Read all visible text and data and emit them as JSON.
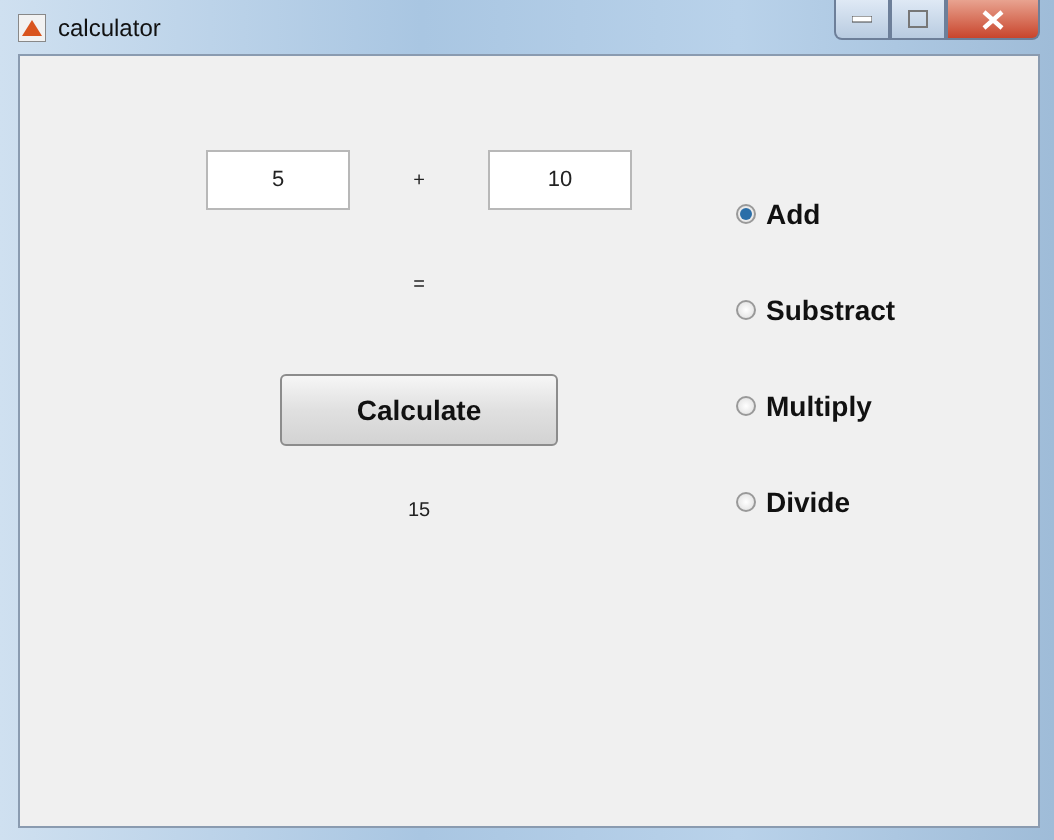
{
  "window": {
    "title": "calculator"
  },
  "operands": [
    {
      "value": "5"
    },
    {
      "value": "10"
    }
  ],
  "operator": "+",
  "equals": "=",
  "calculate_button": "Calculate",
  "result": "15",
  "operations": [
    {
      "label": "Add",
      "selected": true
    },
    {
      "label": "Substract",
      "selected": false
    },
    {
      "label": "Multiply",
      "selected": false
    },
    {
      "label": "Divide",
      "selected": false
    }
  ]
}
